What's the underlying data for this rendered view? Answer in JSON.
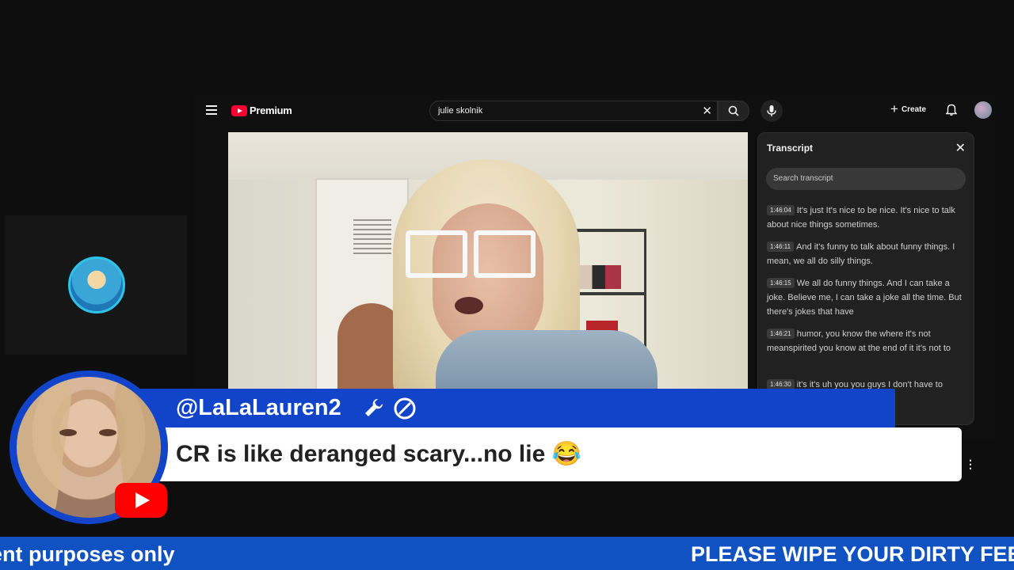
{
  "youtube": {
    "logo_text": "Premium",
    "search": {
      "value": "julie skolnik"
    },
    "create_label": "Create"
  },
  "transcript": {
    "title": "Transcript",
    "search_placeholder": "Search transcript",
    "segments": [
      {
        "time": "1:46:04",
        "text": "It's just It's nice to be nice. It's nice to talk about nice things sometimes."
      },
      {
        "time": "1:46:11",
        "text": "And it's funny to talk about funny things. I mean, we all do silly things."
      },
      {
        "time": "1:46:15",
        "text": "We all do funny things. And I can take a joke. Believe me, I can take a joke all the time. But there's jokes that have"
      },
      {
        "time": "1:46:21",
        "text": "humor, you know the where it's not meanspirited you know at the end of it it's not to"
      },
      {
        "time": "1:46:30",
        "text": "it's it's uh you you guys I don't have to"
      }
    ]
  },
  "chat_overlay": {
    "username": "@LaLaLauren2",
    "message": "CR is like deranged scary...no lie 😂"
  },
  "ticker": {
    "left_text": "ent purposes only",
    "right_text": "PLEASE WIPE YOUR DIRTY FEE"
  },
  "colors": {
    "overlay_blue": "#1144c8",
    "ticker_blue": "#1152c2",
    "youtube_red": "#ff0033"
  }
}
